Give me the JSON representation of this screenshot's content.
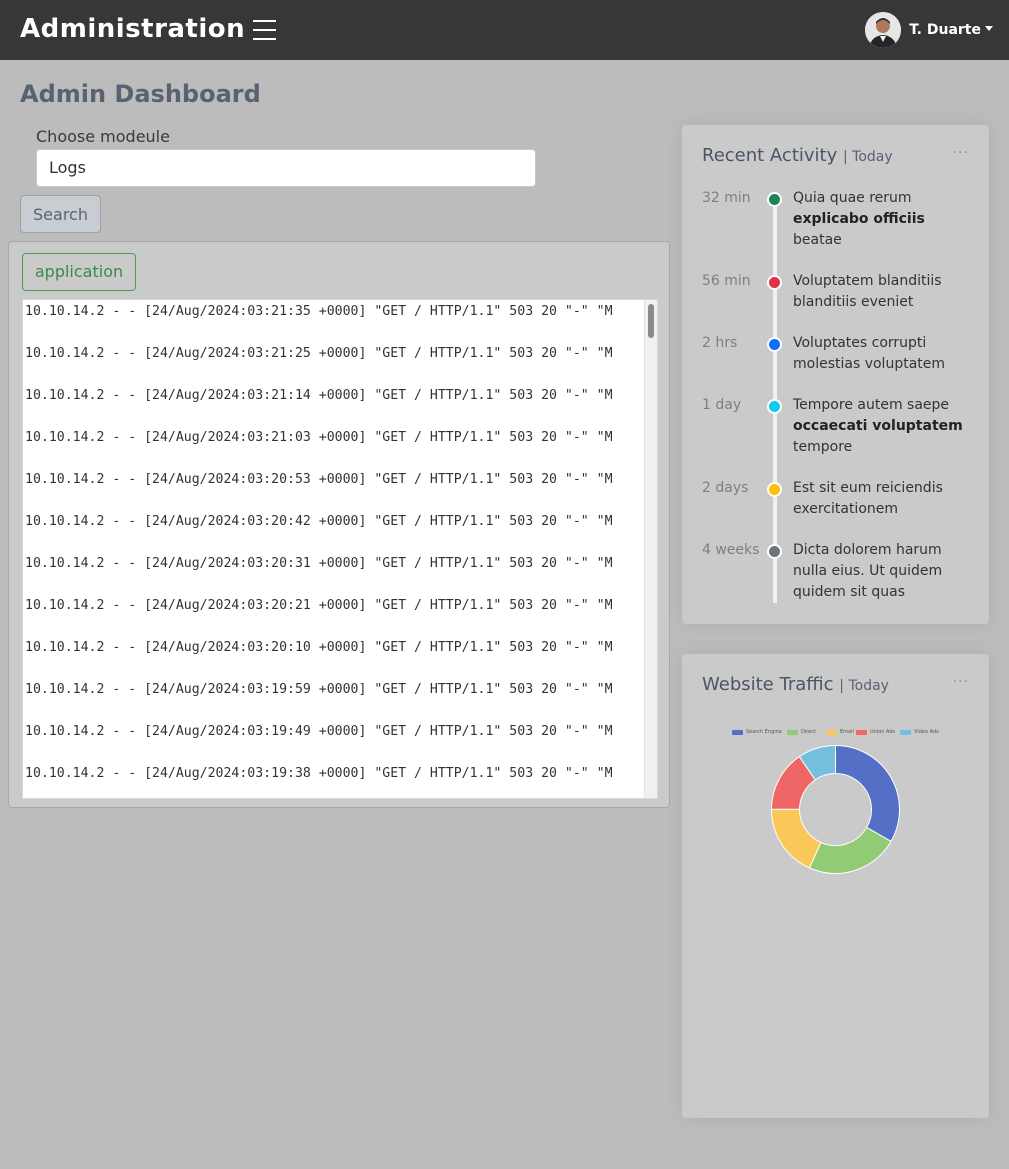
{
  "header": {
    "brand": "Administration",
    "user_name": "T. Duarte"
  },
  "page": {
    "title": "Admin Dashboard",
    "module_label": "Choose modeule",
    "module_value": "Logs",
    "search_label": "Search",
    "badge_label": "application"
  },
  "logs": [
    "10.10.14.2 - - [24/Aug/2024:03:21:35 +0000] \"GET / HTTP/1.1\" 503 20 \"-\" \"M",
    "10.10.14.2 - - [24/Aug/2024:03:21:25 +0000] \"GET / HTTP/1.1\" 503 20 \"-\" \"M",
    "10.10.14.2 - - [24/Aug/2024:03:21:14 +0000] \"GET / HTTP/1.1\" 503 20 \"-\" \"M",
    "10.10.14.2 - - [24/Aug/2024:03:21:03 +0000] \"GET / HTTP/1.1\" 503 20 \"-\" \"M",
    "10.10.14.2 - - [24/Aug/2024:03:20:53 +0000] \"GET / HTTP/1.1\" 503 20 \"-\" \"M",
    "10.10.14.2 - - [24/Aug/2024:03:20:42 +0000] \"GET / HTTP/1.1\" 503 20 \"-\" \"M",
    "10.10.14.2 - - [24/Aug/2024:03:20:31 +0000] \"GET / HTTP/1.1\" 503 20 \"-\" \"M",
    "10.10.14.2 - - [24/Aug/2024:03:20:21 +0000] \"GET / HTTP/1.1\" 503 20 \"-\" \"M",
    "10.10.14.2 - - [24/Aug/2024:03:20:10 +0000] \"GET / HTTP/1.1\" 503 20 \"-\" \"M",
    "10.10.14.2 - - [24/Aug/2024:03:19:59 +0000] \"GET / HTTP/1.1\" 503 20 \"-\" \"M",
    "10.10.14.2 - - [24/Aug/2024:03:19:49 +0000] \"GET / HTTP/1.1\" 503 20 \"-\" \"M",
    "10.10.14.2 - - [24/Aug/2024:03:19:38 +0000] \"GET / HTTP/1.1\" 503 20 \"-\" \"M"
  ],
  "activity": {
    "title": "Recent Activity",
    "subtitle": "| Today",
    "menu": "...",
    "items": [
      {
        "time": "32 min",
        "color": "#198754",
        "pre": "Quia quae rerum ",
        "bold": "explicabo officiis",
        "post": " beatae"
      },
      {
        "time": "56 min",
        "color": "#dc3545",
        "pre": "Voluptatem blanditiis blanditiis eveniet",
        "bold": "",
        "post": ""
      },
      {
        "time": "2 hrs",
        "color": "#0d6efd",
        "pre": "Voluptates corrupti molestias voluptatem",
        "bold": "",
        "post": ""
      },
      {
        "time": "1 day",
        "color": "#0dcaf0",
        "pre": "Tempore autem saepe ",
        "bold": "occaecati voluptatem",
        "post": " tempore"
      },
      {
        "time": "2 days",
        "color": "#ffc107",
        "pre": "Est sit eum reiciendis exercitationem",
        "bold": "",
        "post": ""
      },
      {
        "time": "4 weeks",
        "color": "#6c757d",
        "pre": "Dicta dolorem harum nulla eius. Ut quidem quidem sit quas",
        "bold": "",
        "post": ""
      }
    ]
  },
  "traffic": {
    "title": "Website Traffic",
    "subtitle": "| Today",
    "menu": "..."
  },
  "chart_data": {
    "type": "pie",
    "donut": true,
    "legend_position": "top",
    "categories": [
      "Search Engine",
      "Direct",
      "Email",
      "Union Ads",
      "Video Ads"
    ],
    "values": [
      1048,
      735,
      580,
      484,
      300
    ],
    "colors": [
      "#5470c6",
      "#91cc75",
      "#fac858",
      "#ee6666",
      "#73c0de"
    ]
  }
}
